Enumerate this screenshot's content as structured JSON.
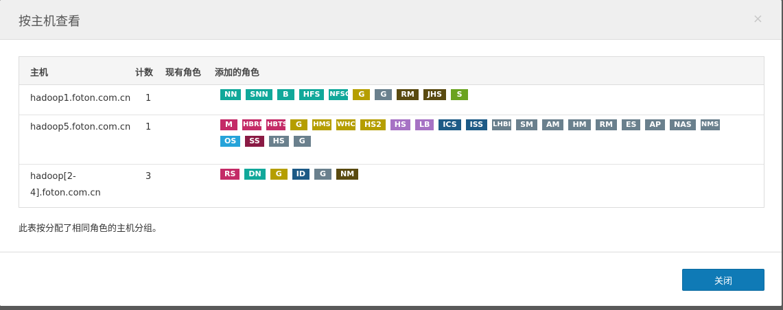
{
  "modal": {
    "title": "按主机查看",
    "close_icon": "×",
    "footnote": "此表按分配了相同角色的主机分组。",
    "close_button_label": "关闭"
  },
  "table": {
    "headers": {
      "host": "主机",
      "count": "计数",
      "existing_roles": "现有角色",
      "added_roles": "添加的角色"
    },
    "rows": [
      {
        "host": "hadoop1.foton.com.cn",
        "count": "1",
        "roles": [
          {
            "label": "NN",
            "color": "#11a89a"
          },
          {
            "label": "SNN",
            "color": "#11a89a"
          },
          {
            "label": "B",
            "color": "#11a89a"
          },
          {
            "label": "HFS",
            "color": "#11a89a"
          },
          {
            "label": "NFSG",
            "color": "#11a89a",
            "narrow": true
          },
          {
            "label": "G",
            "color": "#b59e00"
          },
          {
            "label": "G",
            "color": "#6a808d"
          },
          {
            "label": "RM",
            "color": "#594a10"
          },
          {
            "label": "JHS",
            "color": "#594a10"
          },
          {
            "label": "S",
            "color": "#6aa320"
          }
        ]
      },
      {
        "host": "hadoop5.foton.com.cn",
        "count": "1",
        "roles": [
          {
            "label": "M",
            "color": "#c42b67"
          },
          {
            "label": "HBRE",
            "color": "#c42b67",
            "narrow": true
          },
          {
            "label": "HBTS",
            "color": "#c42b67",
            "narrow": true
          },
          {
            "label": "G",
            "color": "#b59e00"
          },
          {
            "label": "HMS",
            "color": "#b59e00",
            "narrow": true
          },
          {
            "label": "WHC",
            "color": "#b59e00",
            "narrow": true
          },
          {
            "label": "HS2",
            "color": "#b59e00"
          },
          {
            "label": "HS",
            "color": "#a672c4"
          },
          {
            "label": "LB",
            "color": "#a672c4"
          },
          {
            "label": "ICS",
            "color": "#1d5a86"
          },
          {
            "label": "ISS",
            "color": "#1d5a86"
          },
          {
            "label": "LHBI",
            "color": "#6a808d",
            "narrow": true
          },
          {
            "label": "SM",
            "color": "#6a808d"
          },
          {
            "label": "AM",
            "color": "#6a808d"
          },
          {
            "label": "HM",
            "color": "#6a808d"
          },
          {
            "label": "RM",
            "color": "#6a808d"
          },
          {
            "label": "ES",
            "color": "#6a808d"
          },
          {
            "label": "AP",
            "color": "#6a808d"
          },
          {
            "label": "NAS",
            "color": "#6a808d"
          },
          {
            "label": "NMS",
            "color": "#6a808d",
            "narrow": true
          },
          {
            "label": "OS",
            "color": "#26a3d9"
          },
          {
            "label": "SS",
            "color": "#8a1a44"
          },
          {
            "label": "HS",
            "color": "#6a808d"
          },
          {
            "label": "G",
            "color": "#6a808d"
          }
        ]
      },
      {
        "host": "hadoop[2-4].foton.com.cn",
        "host_lines": [
          "hadoop[2-",
          "4].foton.com.cn"
        ],
        "count": "3",
        "roles": [
          {
            "label": "RS",
            "color": "#c42b67"
          },
          {
            "label": "DN",
            "color": "#11a89a"
          },
          {
            "label": "G",
            "color": "#b59e00"
          },
          {
            "label": "ID",
            "color": "#1d5a86"
          },
          {
            "label": "G",
            "color": "#6a808d"
          },
          {
            "label": "NM",
            "color": "#594a10"
          }
        ]
      }
    ]
  }
}
